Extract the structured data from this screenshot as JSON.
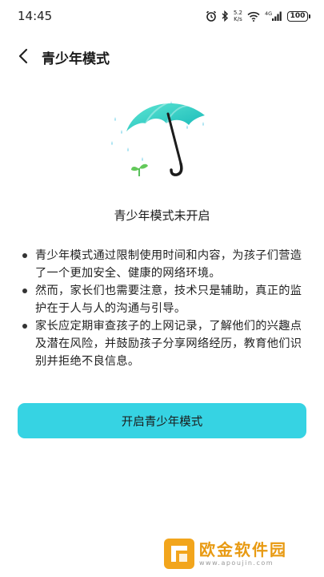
{
  "status_bar": {
    "time": "14:45",
    "net_speed_value": "5.2",
    "net_speed_unit": "K/s",
    "signal_label": "4G",
    "battery": "100"
  },
  "header": {
    "title": "青少年模式"
  },
  "illustration": {
    "icon": "umbrella-rain-sprout"
  },
  "status": {
    "text": "青少年模式未开启"
  },
  "tips": [
    "青少年模式通过限制使用时间和内容，为孩子们营造了一个更加安全、健康的网络环境。",
    "然而，家长们也需要注意，技术只是辅助，真正的监护在于人与人的沟通与引导。",
    "家长应定期审查孩子的上网记录，了解他们的兴趣点及潜在风险，并鼓励孩子分享网络经历，教育他们识别并拒绝不良信息。"
  ],
  "action": {
    "enable_label": "开启青少年模式"
  },
  "watermark": {
    "name": "欧金软件园",
    "url": "www.apoujin.com"
  },
  "colors": {
    "accent": "#36d3e3",
    "umbrella": "#2fd1c4",
    "watermark": "#e89a12"
  }
}
